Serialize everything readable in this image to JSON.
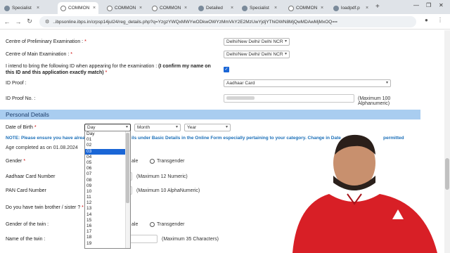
{
  "browser": {
    "tabs": [
      {
        "title": "Specialist",
        "active": false
      },
      {
        "title": "COMMON",
        "active": true
      },
      {
        "title": "COMMON",
        "active": false
      },
      {
        "title": "COMMON",
        "active": false
      },
      {
        "title": "Detailed",
        "active": false
      },
      {
        "title": "Specialist",
        "active": false
      },
      {
        "title": "COMMON",
        "active": false
      },
      {
        "title": "loadpdf.p",
        "active": false
      }
    ],
    "new_tab": "+",
    "url": "..ibpsonline.ibps.in/crpsp14jul24/reg_details.php?q=YzgzYWQxMWYwODkwOWYzMmVkY2E2MzUwYjdjYThiOWN8MjQwMDAwMjMxOQ=="
  },
  "form": {
    "centre_prelim": {
      "label": "Centre of Preliminary Examination :",
      "req": "*",
      "value": "Delhi/New Delhi/ Delhi NCR"
    },
    "centre_main": {
      "label": "Centre of Main Examination :",
      "req": "*",
      "value": "Delhi/New Delhi/ Delhi NCR"
    },
    "id_confirm": {
      "label_plain": "I intend to bring the following ID when appearing for the examination :",
      "label_bold": "(I confirm my name on this ID and this application exactly match)",
      "req": "*"
    },
    "id_proof": {
      "label": "ID Proof :",
      "value": "Aadhaar Card"
    },
    "id_proof_no": {
      "label": "ID Proof No. :",
      "hint": "(Maximum 100 Alphanumeric)"
    },
    "section_personal": "Personal Details",
    "dob": {
      "label": "Date of Birth",
      "req": "*",
      "day": "Day",
      "month": "Month",
      "year": "Year"
    },
    "note_prefix": "NOTE: Please ensure you have alread",
    "note_suffix": "ils under Basic Details in the Online Form especially pertaining to your category. Change in Date",
    "note_end": "permitted",
    "age": "Age completed as on 01.08.2024",
    "gender": {
      "label": "Gender",
      "req": "*",
      "female_partial": "ale",
      "transgender": "Transgender"
    },
    "aadhaar": {
      "label": "Aadhaar Card Number",
      "hint": "(Maximum 12 Numeric)"
    },
    "pan": {
      "label": "PAN Card Number",
      "hint": "(Maximum 10 AlphaNumeric)"
    },
    "twin": {
      "label": "Do you have twin brother / sister ?",
      "req": "*"
    },
    "twin_gender": {
      "label": "Gender of the twin :",
      "female_partial": "ale",
      "transgender": "Transgender"
    },
    "twin_name": {
      "label": "Name of the twin :",
      "hint": "(Maximum 35 Characters)"
    }
  },
  "day_dropdown": {
    "options": [
      "Day",
      "01",
      "02",
      "03",
      "04",
      "05",
      "06",
      "07",
      "08",
      "09",
      "10",
      "11",
      "12",
      "13",
      "14",
      "15",
      "16",
      "17",
      "18",
      "19"
    ],
    "selected": "03"
  },
  "colors": {
    "accent": "#1a66d6",
    "section_band": "#a9cdf0",
    "note_text": "#1b6fb8"
  }
}
